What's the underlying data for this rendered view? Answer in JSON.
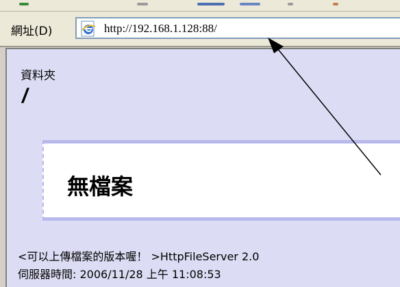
{
  "address_bar": {
    "label": "網址(D)",
    "url": "http://192.168.1.128:88/"
  },
  "page": {
    "folder_label": "資料夾",
    "folder_path": "/",
    "no_files_text": "無檔案",
    "footer_version": "<可以上傳檔案的版本喔！ >HttpFileServer 2.0",
    "footer_time": "伺服器時間: 2006/11/28 上午 11:08:53"
  },
  "icons": {
    "browser_page_icon": "ie-page-icon",
    "annotation": "arrow-annotation"
  },
  "colors": {
    "page_background": "#dcdcf4",
    "panel_border": "#b8b8ec"
  }
}
